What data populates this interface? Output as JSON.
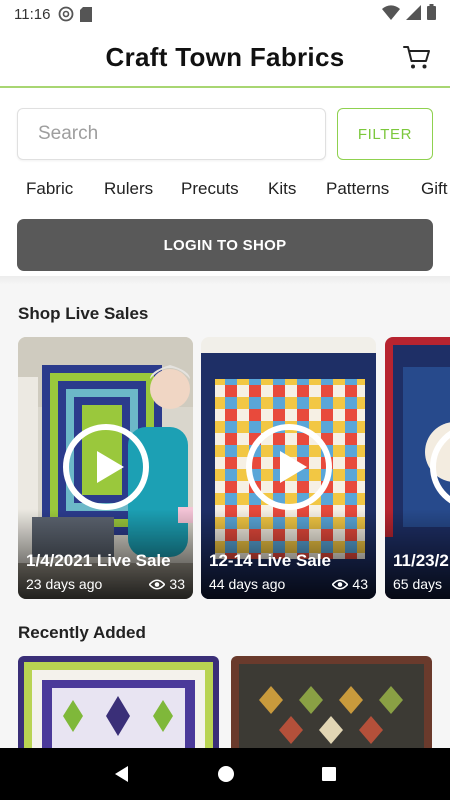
{
  "status_bar": {
    "time": "11:16",
    "icons": [
      "at-icon",
      "sd-card-icon",
      "wifi-icon",
      "signal-icon",
      "battery-icon"
    ]
  },
  "header": {
    "title": "Craft Town Fabrics",
    "cart_icon": "cart-icon",
    "accent_color": "#a8d672"
  },
  "search": {
    "placeholder": "Search",
    "value": "",
    "filter_label": "FILTER"
  },
  "categories": [
    "Fabric",
    "Rulers",
    "Precuts",
    "Kits",
    "Patterns",
    "Gift"
  ],
  "login_button": "LOGIN TO SHOP",
  "live_sales": {
    "title": "Shop Live Sales",
    "items": [
      {
        "name": "1/4/2021 Live Sale",
        "ago": "23 days ago",
        "views": "33"
      },
      {
        "name": "12-14 Live Sale",
        "ago": "44 days ago",
        "views": "43"
      },
      {
        "name": "11/23/2",
        "ago": "65 days",
        "views": ""
      }
    ]
  },
  "recently_added": {
    "title": "Recently Added"
  },
  "navigation": {
    "back": "back-icon",
    "home": "home-icon",
    "recents": "recents-icon"
  },
  "colors": {
    "login_bg": "#595959",
    "filter_green": "#7cc83c"
  }
}
